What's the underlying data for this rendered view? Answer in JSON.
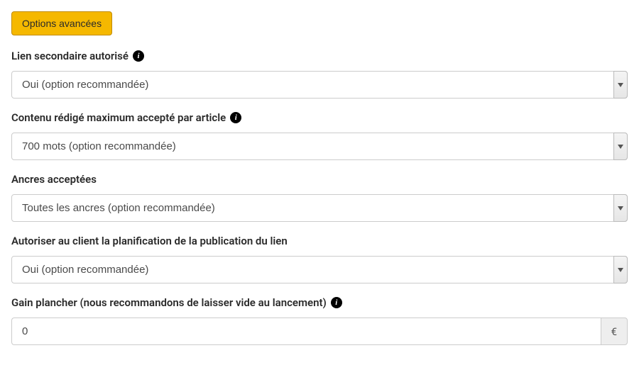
{
  "advancedButton": {
    "label": "Options avancées"
  },
  "fields": {
    "secondaryLink": {
      "label": "Lien secondaire autorisé",
      "value": "Oui (option recommandée)"
    },
    "maxContent": {
      "label": "Contenu rédigé maximum accepté par article",
      "value": "700 mots (option recommandée)"
    },
    "anchors": {
      "label": "Ancres acceptées",
      "value": "Toutes les ancres (option recommandée)"
    },
    "scheduling": {
      "label": "Autoriser au client la planification de la publication du lien",
      "value": "Oui (option recommandée)"
    },
    "floorGain": {
      "label": "Gain plancher (nous recommandons de laisser vide au lancement)",
      "value": "0",
      "currency": "€"
    }
  },
  "info": "i"
}
